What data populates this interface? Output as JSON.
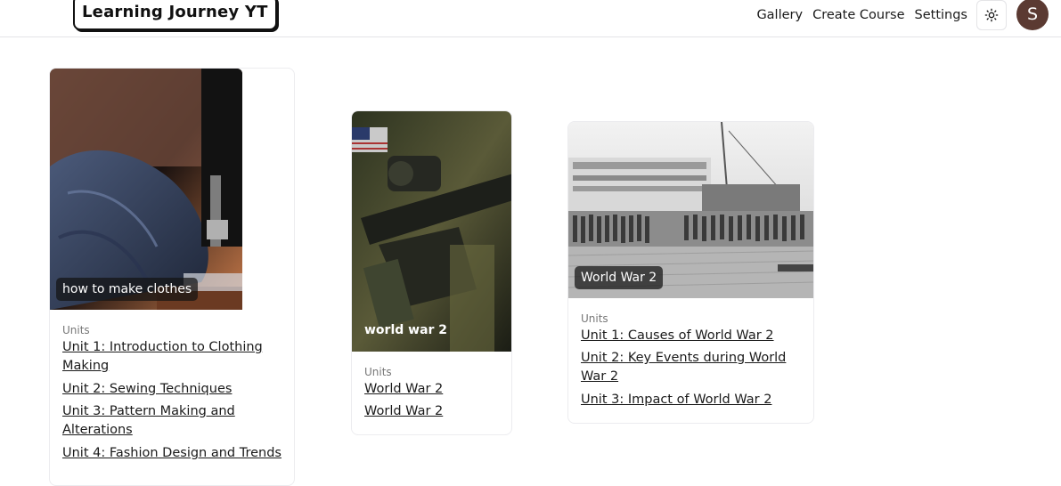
{
  "header": {
    "logo": "Learning Journey YT",
    "nav": [
      "Gallery",
      "Create Course",
      "Settings"
    ],
    "theme_icon": "sun-icon",
    "avatar_initial": "S"
  },
  "courses": [
    {
      "title": "how to make clothes",
      "image": "sewing-machine-photo",
      "units_label": "Units",
      "units": [
        "Unit 1: Introduction to Clothing Making",
        "Unit 2: Sewing Techniques",
        "Unit 3: Pattern Making and Alterations",
        "Unit 4: Fashion Design and Trends"
      ]
    },
    {
      "title": "world war 2",
      "image": "rifle-photo",
      "units_label": "Units",
      "units": [
        "World War 2",
        "World War 2"
      ]
    },
    {
      "title": "World War 2",
      "image": "troops-at-dock-photo",
      "units_label": "Units",
      "units": [
        "Unit 1: Causes of World War 2",
        "Unit 2: Key Events during World War 2",
        "Unit 3: Impact of World War 2"
      ]
    }
  ]
}
